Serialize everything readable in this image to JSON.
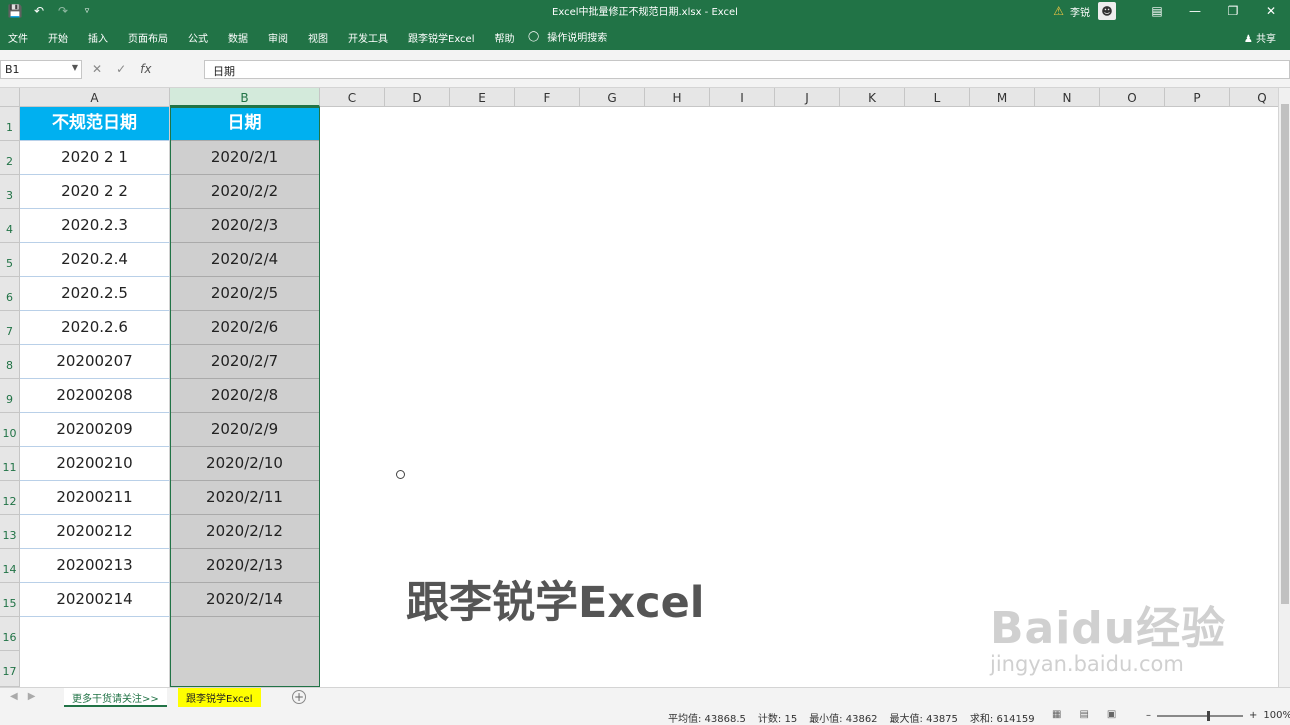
{
  "window": {
    "title": "Excel中批量修正不规范日期.xlsx  -  Excel",
    "user": "李锐",
    "warning_icon": "warning-icon"
  },
  "ribbon": {
    "tabs": [
      "文件",
      "开始",
      "插入",
      "页面布局",
      "公式",
      "数据",
      "审阅",
      "视图",
      "开发工具",
      "跟李锐学Excel",
      "帮助"
    ],
    "tell_me": "操作说明搜索",
    "share": "共享"
  },
  "formula_bar": {
    "name_box": "B1",
    "fx": "fx",
    "content": "日期"
  },
  "columns": [
    "A",
    "B",
    "C",
    "D",
    "E",
    "F",
    "G",
    "H",
    "I",
    "J",
    "K",
    "L",
    "M",
    "N",
    "O",
    "P",
    "Q"
  ],
  "rows": [
    "1",
    "2",
    "3",
    "4",
    "5",
    "6",
    "7",
    "8",
    "9",
    "10",
    "11",
    "12",
    "13",
    "14",
    "15",
    "16",
    "17"
  ],
  "table": {
    "headers": [
      "不规范日期",
      "日期"
    ],
    "rows": [
      [
        "2020 2 1",
        "2020/2/1"
      ],
      [
        "2020 2 2",
        "2020/2/2"
      ],
      [
        "2020.2.3",
        "2020/2/3"
      ],
      [
        "2020.2.4",
        "2020/2/4"
      ],
      [
        "2020.2.5",
        "2020/2/5"
      ],
      [
        "2020.2.6",
        "2020/2/6"
      ],
      [
        "20200207",
        "2020/2/7"
      ],
      [
        "20200208",
        "2020/2/8"
      ],
      [
        "20200209",
        "2020/2/9"
      ],
      [
        "20200210",
        "2020/2/10"
      ],
      [
        "20200211",
        "2020/2/11"
      ],
      [
        "20200212",
        "2020/2/12"
      ],
      [
        "20200213",
        "2020/2/13"
      ],
      [
        "20200214",
        "2020/2/14"
      ]
    ]
  },
  "overlay_text": "跟李锐学Excel",
  "watermark": {
    "logo": "Baidu经验",
    "url": "jingyan.baidu.com"
  },
  "sheets": {
    "tab1": "更多干货请关注>>",
    "tab2": "跟李锐学Excel"
  },
  "status": {
    "average": "平均值: 43868.5",
    "count": "计数: 15",
    "min": "最小值: 43862",
    "max": "最大值: 43875",
    "sum": "求和: 614159",
    "zoom": "100%"
  },
  "colors": {
    "accent": "#217346",
    "header_fill": "#00b0f0",
    "sheet_tab_highlight": "#ffff00"
  }
}
